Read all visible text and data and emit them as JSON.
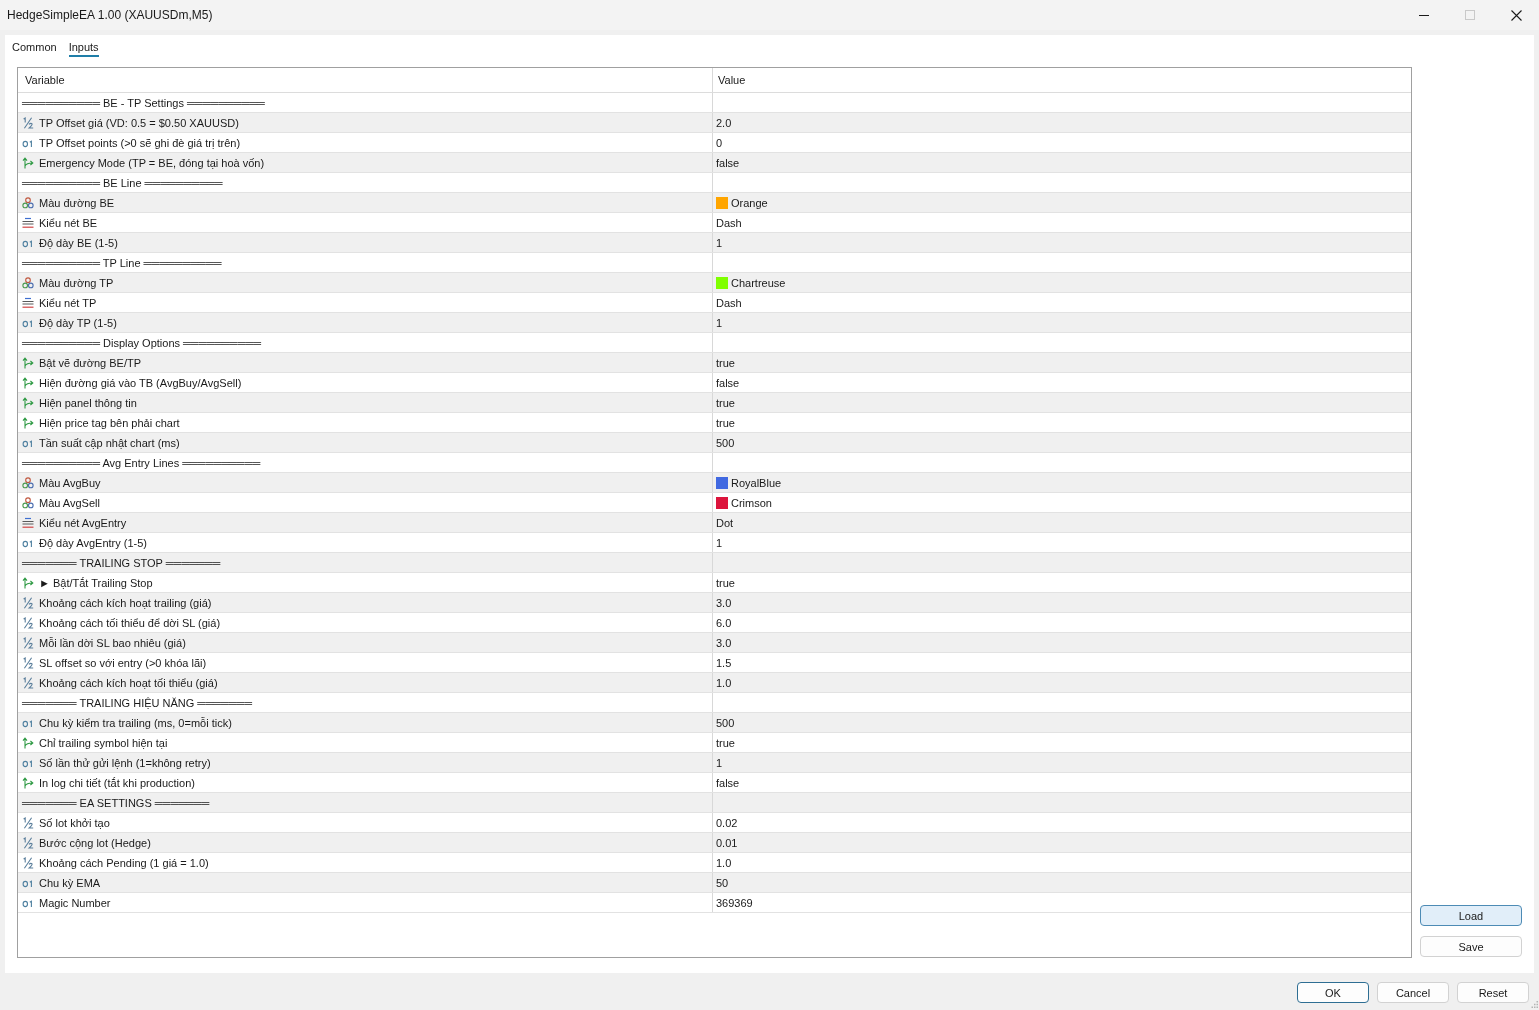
{
  "window": {
    "title": "HedgeSimpleEA 1.00 (XAUUSDm,M5)",
    "maximize_disabled": true
  },
  "tabs": [
    {
      "label": "Common",
      "selected": false
    },
    {
      "label": "Inputs",
      "selected": true
    }
  ],
  "table": {
    "columns": [
      "Variable",
      "Value"
    ],
    "rows": [
      {
        "kind": "separator",
        "name": "══════════ BE - TP Settings ══════════"
      },
      {
        "kind": "double",
        "name": "TP Offset giá (VD: 0.5 = $0.50 XAUUSD)",
        "value": "2.0"
      },
      {
        "kind": "int",
        "name": "TP Offset points (>0 sẽ ghi đè giá trị trên)",
        "value": "0"
      },
      {
        "kind": "bool",
        "name": "Emergency Mode (TP = BE, đóng tại hoà vốn)",
        "value": "false"
      },
      {
        "kind": "separator",
        "name": "══════════ BE Line ══════════"
      },
      {
        "kind": "color",
        "name": "Màu đường BE",
        "value": "Orange",
        "color": "#ffa500"
      },
      {
        "kind": "enum",
        "name": "Kiểu nét BE",
        "value": "Dash"
      },
      {
        "kind": "int",
        "name": "Độ dày BE (1-5)",
        "value": "1"
      },
      {
        "kind": "separator",
        "name": "══════════ TP Line ══════════"
      },
      {
        "kind": "color",
        "name": "Màu đường TP",
        "value": "Chartreuse",
        "color": "#7fff00"
      },
      {
        "kind": "enum",
        "name": "Kiểu nét TP",
        "value": "Dash"
      },
      {
        "kind": "int",
        "name": "Độ dày TP (1-5)",
        "value": "1"
      },
      {
        "kind": "separator",
        "name": "══════════ Display Options ══════════"
      },
      {
        "kind": "bool",
        "name": "Bật vẽ đường BE/TP",
        "value": "true"
      },
      {
        "kind": "bool",
        "name": "Hiện đường giá vào TB (AvgBuy/AvgSell)",
        "value": "false"
      },
      {
        "kind": "bool",
        "name": "Hiện panel thông tin",
        "value": "true"
      },
      {
        "kind": "bool",
        "name": "Hiện price tag bên phải chart",
        "value": "true"
      },
      {
        "kind": "int",
        "name": "Tần suất cập nhật chart (ms)",
        "value": "500"
      },
      {
        "kind": "separator",
        "name": "══════════ Avg Entry Lines ══════════"
      },
      {
        "kind": "color",
        "name": "Màu AvgBuy",
        "value": "RoyalBlue",
        "color": "#4169e1"
      },
      {
        "kind": "color",
        "name": "Màu AvgSell",
        "value": "Crimson",
        "color": "#dc143c"
      },
      {
        "kind": "enum",
        "name": "Kiểu nét AvgEntry",
        "value": "Dot"
      },
      {
        "kind": "int",
        "name": "Độ dày AvgEntry (1-5)",
        "value": "1"
      },
      {
        "kind": "separator",
        "name": "═══════ TRAILING STOP ═══════"
      },
      {
        "kind": "bool",
        "name": "► Bật/Tắt Trailing Stop",
        "value": "true"
      },
      {
        "kind": "double",
        "name": "Khoảng cách kích hoạt trailing (giá)",
        "value": "3.0"
      },
      {
        "kind": "double",
        "name": "Khoảng cách tối thiểu để dời SL (giá)",
        "value": "6.0"
      },
      {
        "kind": "double",
        "name": "Mỗi lần dời SL bao nhiêu (giá)",
        "value": "3.0"
      },
      {
        "kind": "double",
        "name": "SL offset so với entry (>0 khóa lãi)",
        "value": "1.5"
      },
      {
        "kind": "double",
        "name": "Khoảng cách kích hoạt tối thiểu (giá)",
        "value": "1.0"
      },
      {
        "kind": "separator",
        "name": "═══════ TRAILING HIỆU NĂNG ═══════"
      },
      {
        "kind": "int",
        "name": "Chu kỳ kiểm tra trailing (ms, 0=mỗi tick)",
        "value": "500"
      },
      {
        "kind": "bool",
        "name": "Chỉ trailing symbol hiện tại",
        "value": "true"
      },
      {
        "kind": "int",
        "name": "Số lần thử gửi lệnh (1=không retry)",
        "value": "1"
      },
      {
        "kind": "bool",
        "name": "In log chi tiết (tắt khi production)",
        "value": "false"
      },
      {
        "kind": "separator",
        "name": "═══════ EA SETTINGS ═══════"
      },
      {
        "kind": "double",
        "name": "Số lot khởi tạo",
        "value": "0.02"
      },
      {
        "kind": "double",
        "name": "Bước cộng lot (Hedge)",
        "value": "0.01"
      },
      {
        "kind": "double",
        "name": "Khoảng cách Pending (1 giá = 1.0)",
        "value": "1.0"
      },
      {
        "kind": "int",
        "name": "Chu kỳ EMA",
        "value": "50"
      },
      {
        "kind": "int",
        "name": "Magic Number",
        "value": "369369"
      }
    ]
  },
  "side_buttons": [
    {
      "label": "Load",
      "hovered": true
    },
    {
      "label": "Save",
      "hovered": false
    }
  ],
  "footer_buttons": [
    {
      "label": "OK",
      "default": true
    },
    {
      "label": "Cancel",
      "default": false
    },
    {
      "label": "Reset",
      "default": false
    }
  ]
}
